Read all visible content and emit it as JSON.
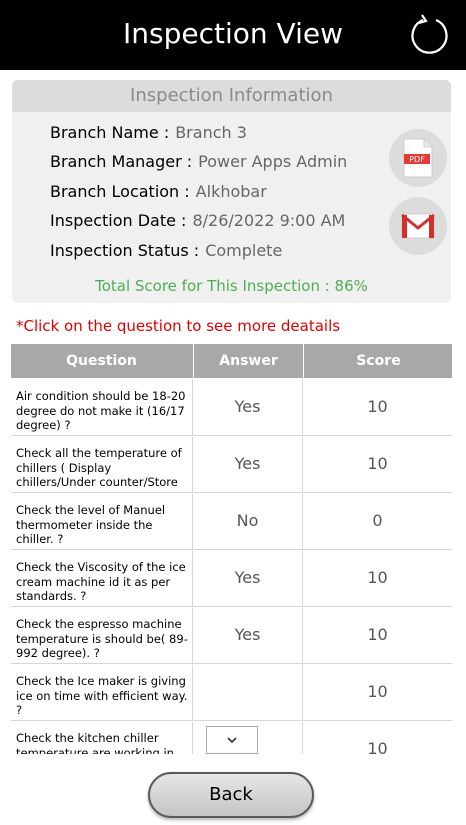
{
  "header": {
    "title": "Inspection View",
    "refresh_icon": "refresh-icon"
  },
  "info": {
    "heading": "Inspection Information",
    "fields": [
      {
        "label": "Branch Name :",
        "value": "Branch 3"
      },
      {
        "label": "Branch Manager :",
        "value": "Power Apps Admin"
      },
      {
        "label": "Branch Location :",
        "value": "Alkhobar"
      },
      {
        "label": "Inspection Date :",
        "value": "8/26/2022 9:00 AM"
      },
      {
        "label": "Inspection Status :",
        "value": "Complete"
      }
    ],
    "pdf_icon_text": "PDF",
    "total_score": "Total Score for This Inspection : 86%"
  },
  "note": "*Click on the question to see more deatails",
  "table": {
    "headers": {
      "question": "Question",
      "answer": "Answer",
      "score": "Score"
    },
    "rows": [
      {
        "question": "Air condition should be 18-20 degree do not make it (16/17 degree) ?",
        "answer": "Yes",
        "score": "10"
      },
      {
        "question": "Check all the temperature of chillers ( Display chillers/Under counter/Store",
        "answer": "Yes",
        "score": "10"
      },
      {
        "question": "Check the level of Manuel thermometer inside the chiller. ?",
        "answer": "No",
        "score": "0"
      },
      {
        "question": "Check the Viscosity of the ice cream machine id it as per standards. ?",
        "answer": "Yes",
        "score": "10"
      },
      {
        "question": "Check the espresso machine temperature is should be( 89-992 degree). ?",
        "answer": "Yes",
        "score": "10"
      },
      {
        "question": "Check the Ice maker is giving ice on time with efficient way. ?",
        "answer": "",
        "score": "10"
      },
      {
        "question": "Check the kitchen chiller temperature are working in",
        "answer": "",
        "score": "10"
      }
    ]
  },
  "back_label": "Back",
  "colors": {
    "header_bg": "#000000",
    "total_score": "#4caf50",
    "note": "#e00000",
    "table_header": "#a8a8a8"
  }
}
